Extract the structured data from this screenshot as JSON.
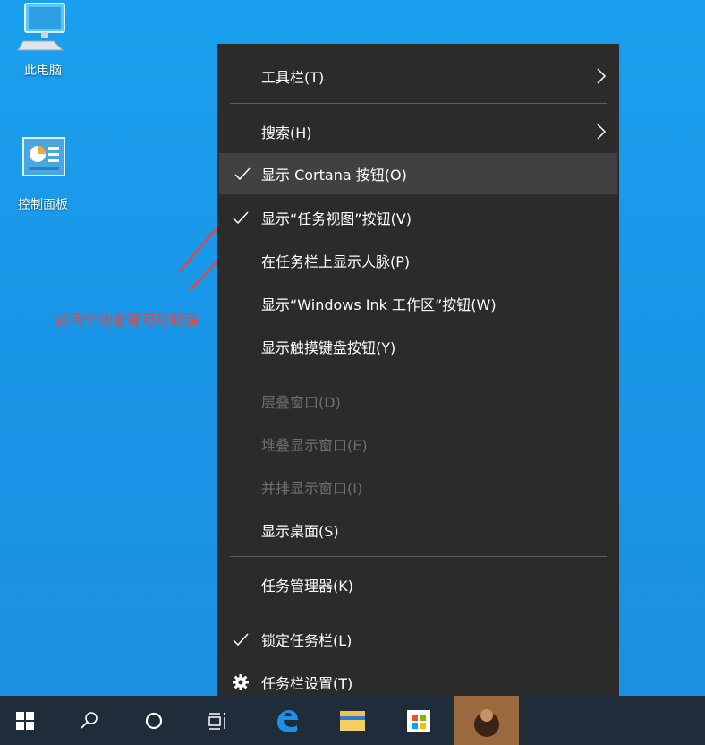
{
  "desktop": {
    "icons": [
      {
        "label": "此电脑",
        "icon": "this-pc-icon"
      },
      {
        "label": "控制面板",
        "icon": "control-panel-icon"
      }
    ],
    "annotation": "这两个功能都可以取消",
    "annotation_color": "#e8453c"
  },
  "menu": {
    "items": [
      {
        "label": "工具栏(T)",
        "submenu": true
      },
      {
        "label": "搜索(H)",
        "submenu": true
      },
      {
        "label": "显示 Cortana 按钮(O)",
        "checked": true,
        "highlighted": true
      },
      {
        "label": "显示“任务视图”按钮(V)",
        "checked": true
      },
      {
        "label": "在任务栏上显示人脉(P)"
      },
      {
        "label": "显示“Windows Ink 工作区”按钮(W)"
      },
      {
        "label": "显示触摸键盘按钮(Y)"
      },
      {
        "label": "层叠窗口(D)",
        "disabled": true
      },
      {
        "label": "堆叠显示窗口(E)",
        "disabled": true
      },
      {
        "label": "并排显示窗口(I)",
        "disabled": true
      },
      {
        "label": "显示桌面(S)"
      },
      {
        "label": "任务管理器(K)"
      },
      {
        "label": "锁定任务栏(L)",
        "checked": true
      },
      {
        "label": "任务栏设置(T)",
        "icon": "gear-icon"
      }
    ]
  },
  "taskbar": {
    "buttons": [
      "windows-start-icon",
      "search-icon",
      "cortana-icon",
      "task-view-icon",
      "edge-icon",
      "file-explorer-icon",
      "store-icon",
      "app-icon"
    ]
  },
  "colors": {
    "desktop_bg": "#1a97e8",
    "menu_bg": "#2b2b2b",
    "highlight_bg": "#414141",
    "disabled_text": "#6f6f6f",
    "taskbar_bg": "#1f2d3a"
  }
}
